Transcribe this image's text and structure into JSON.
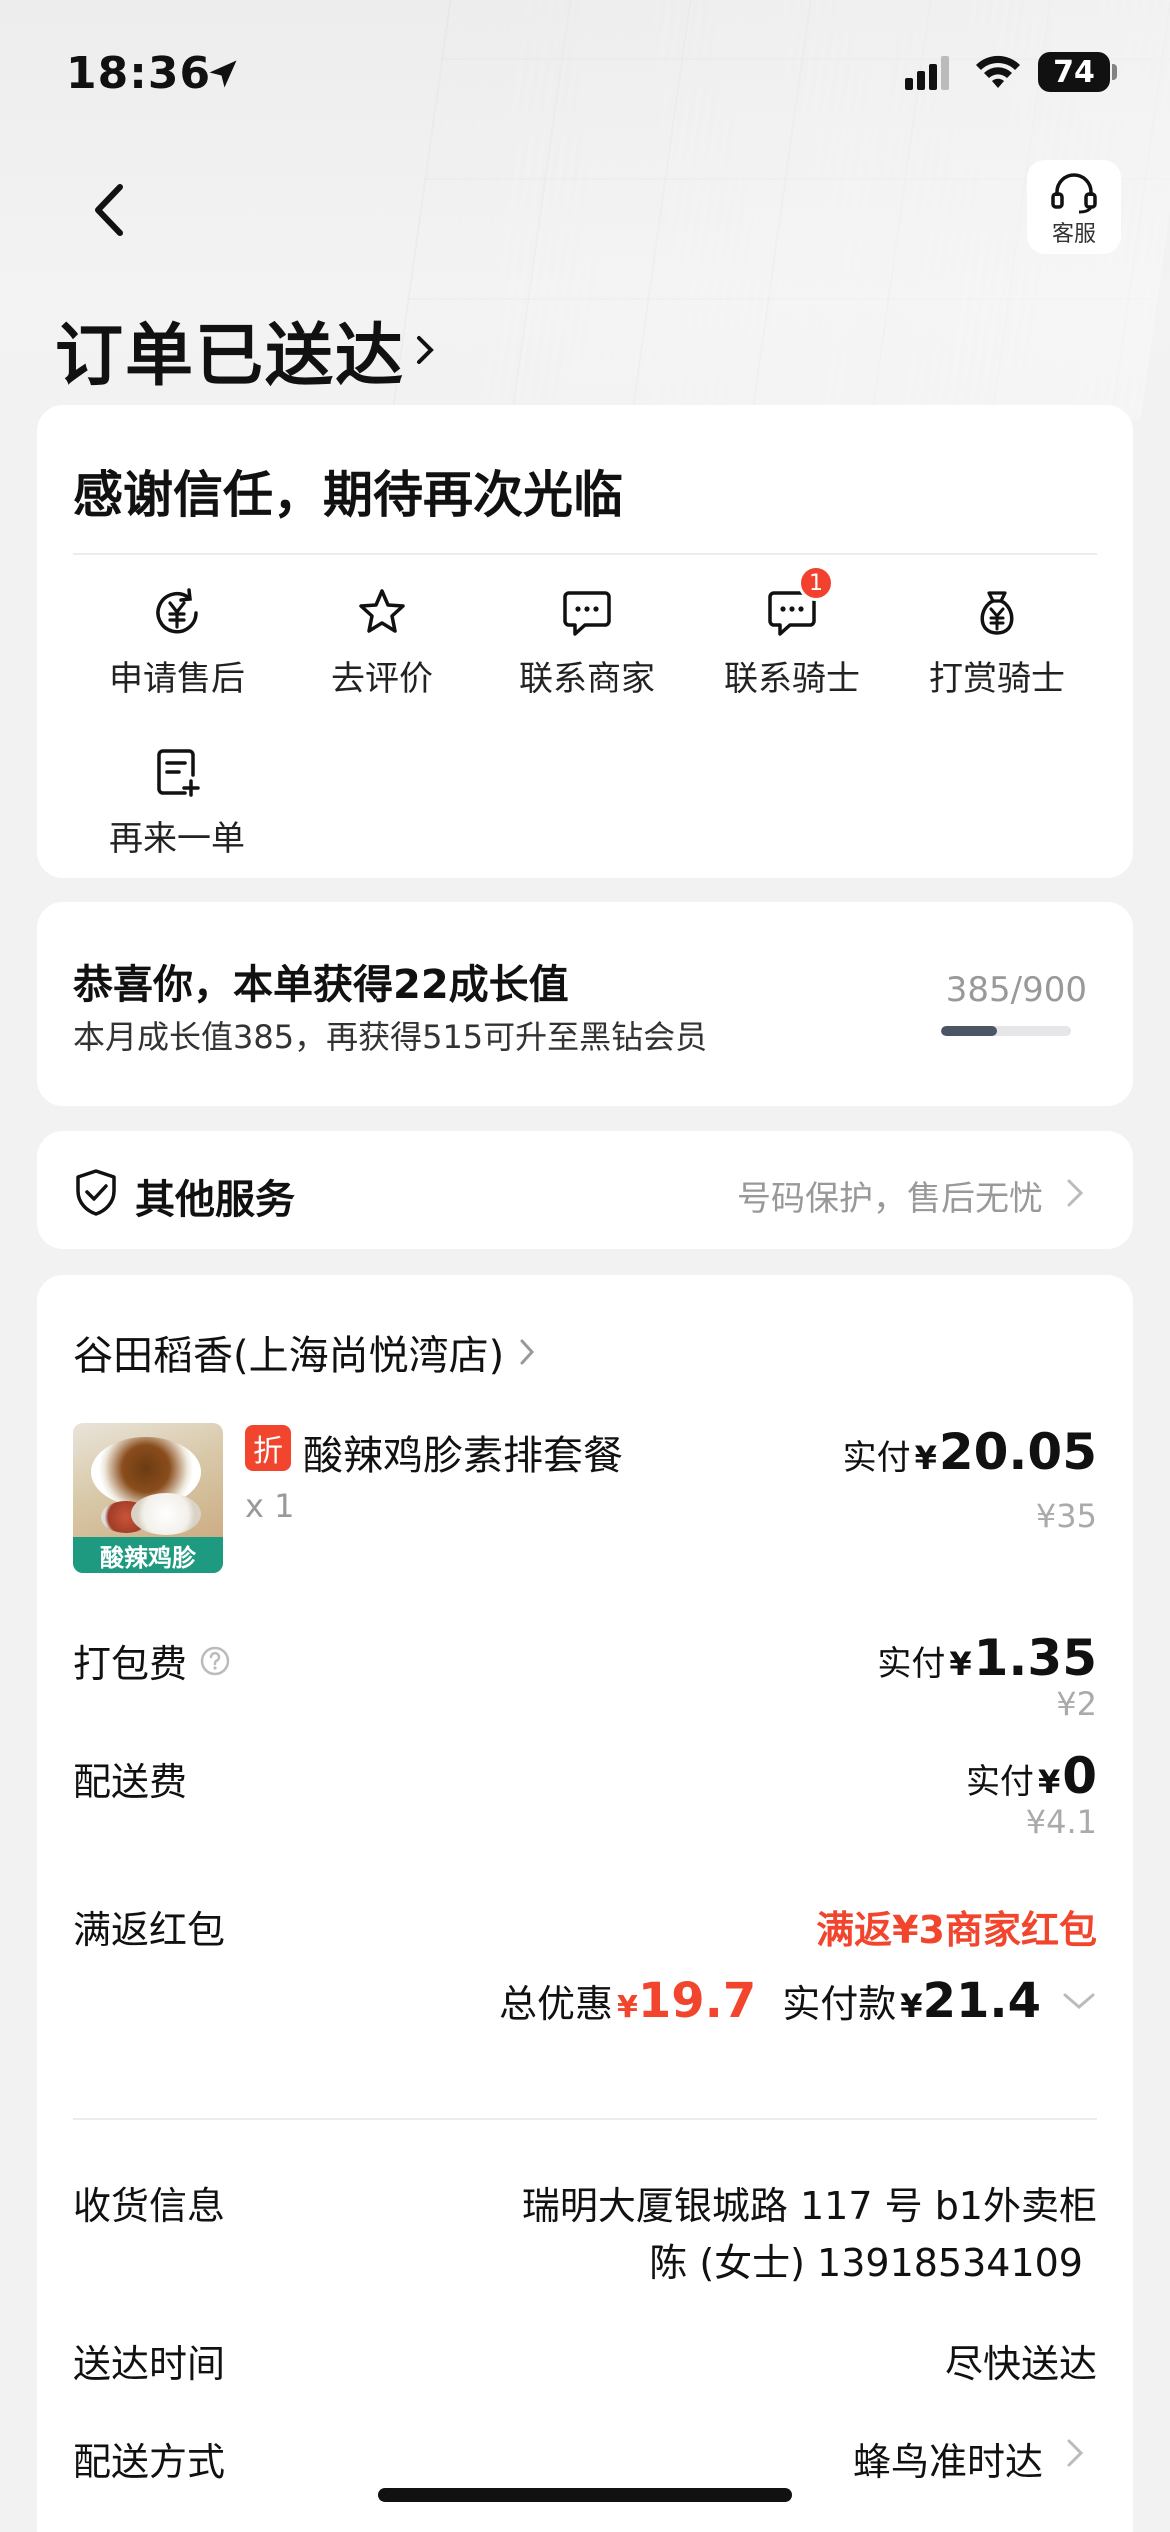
{
  "status_bar": {
    "time": "18:36",
    "battery": "74"
  },
  "nav": {
    "service_label": "客服"
  },
  "header": {
    "title": "订单已送达"
  },
  "thanks_card": {
    "message": "感谢信任，期待再次光临",
    "actions": [
      {
        "label": "申请售后",
        "icon": "refund-icon"
      },
      {
        "label": "去评价",
        "icon": "star-icon"
      },
      {
        "label": "联系商家",
        "icon": "chat-icon"
      },
      {
        "label": "联系骑士",
        "icon": "chat-icon",
        "badge": "1"
      },
      {
        "label": "打赏骑士",
        "icon": "money-bag-icon"
      },
      {
        "label": "再来一单",
        "icon": "reorder-icon"
      }
    ]
  },
  "growth_card": {
    "title": "恭喜你，本单获得22成长值",
    "desc": "本月成长值385，再获得515可升至黑钻会员",
    "count": "385/900",
    "progress": 0.43
  },
  "services_card": {
    "title": "其他服务",
    "desc": "号码保护，售后无忧"
  },
  "order_card": {
    "shop_name": "谷田稻香(上海尚悦湾店)",
    "item": {
      "discount_tag": "折",
      "name": "酸辣鸡胗素排套餐",
      "image_label": "酸辣鸡胗",
      "qty": "x 1",
      "paid_label": "实付",
      "currency": "¥",
      "paid": "20.05",
      "original": "¥35"
    },
    "packing": {
      "label": "打包费",
      "paid_label": "实付",
      "currency": "¥",
      "paid": "1.35",
      "original": "¥2"
    },
    "delivery": {
      "label": "配送费",
      "paid_label": "实付",
      "currency": "¥",
      "paid": "0",
      "original": "¥4.1"
    },
    "red_packet": {
      "label": "满返红包",
      "value": "满返¥3商家红包"
    },
    "totals": {
      "discount_label": "总优惠",
      "currency": "¥",
      "discount": "19.7",
      "paid_label": "实付款",
      "paid": "21.4"
    },
    "info": {
      "address_label": "收货信息",
      "address": "瑞明大厦银城路 117 号 b1外卖柜",
      "contact": "陈 (女士) 13918534109",
      "time_label": "送达时间",
      "time": "尽快送达",
      "method_label": "配送方式",
      "method": "蜂鸟准时达"
    }
  },
  "colors": {
    "accent_red": "#f2452e",
    "badge_red": "#f2422f",
    "image_tag_green": "#1e9a80"
  }
}
